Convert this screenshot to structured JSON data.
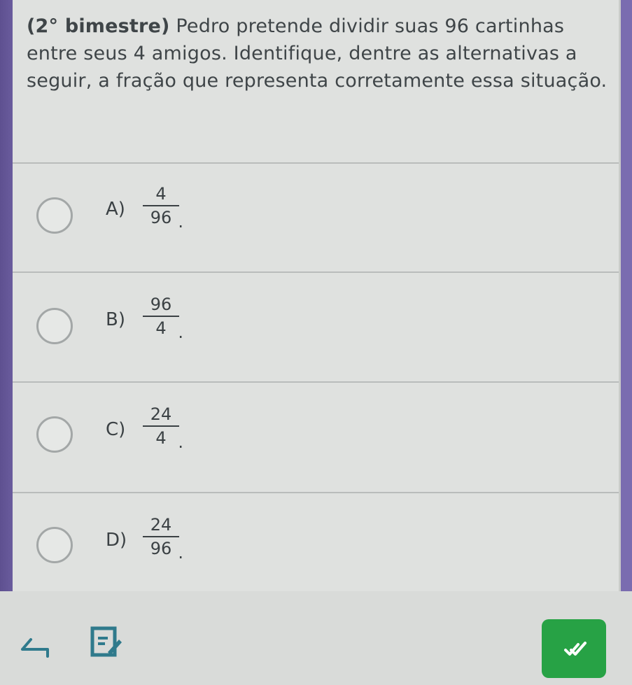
{
  "question": {
    "lead": "(2° bimestre)",
    "text": " Pedro pretende dividir suas 96 cartinhas entre seus 4 amigos. Identifique, dentre as alternativas a seguir, a fração que representa corretamente essa situação."
  },
  "options": [
    {
      "letter": "A)",
      "numerator": "4",
      "denominator": "96",
      "suffix": "."
    },
    {
      "letter": "B)",
      "numerator": "96",
      "denominator": "4",
      "suffix": "."
    },
    {
      "letter": "C)",
      "numerator": "24",
      "denominator": "4",
      "suffix": "."
    },
    {
      "letter": "D)",
      "numerator": "24",
      "denominator": "96",
      "suffix": "."
    }
  ],
  "toolbar": {
    "back_icon": "back-arrow-icon",
    "notes_icon": "notes-edit-icon",
    "confirm_icon": "double-check-icon"
  },
  "colors": {
    "accent": "#27a245",
    "background": "#7a6cb0",
    "card": "#dfe1df",
    "text": "#3b4144"
  }
}
